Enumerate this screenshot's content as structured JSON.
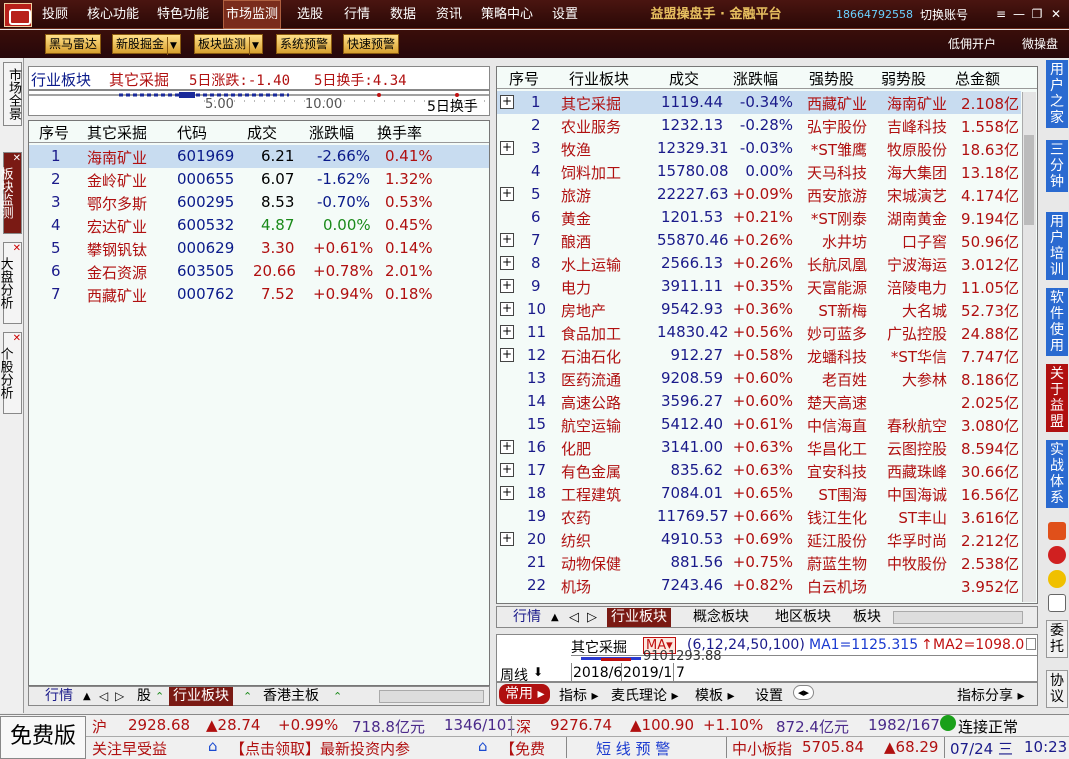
{
  "menu": {
    "items": [
      "投顾",
      "核心功能",
      "特色功能",
      "市场监测",
      "选股",
      "行情",
      "数据",
      "资讯",
      "策略中心",
      "设置"
    ],
    "active": "市场监测",
    "brand": "益盟操盘手 · 金融平台",
    "phone": "18664792558",
    "switch_account": "切换账号"
  },
  "toolbar": {
    "buttons": [
      "黑马雷达",
      "新股掘金",
      "板块监测",
      "系统预警",
      "快速预警"
    ],
    "dropdowns": [
      "新股掘金",
      "板块监测"
    ],
    "links": [
      "低佣开户",
      "微操盘"
    ]
  },
  "left_tabs": [
    "市场全景",
    "板块监测",
    "大盘分析",
    "个股分析"
  ],
  "left_panel": {
    "title": "行业板块",
    "sector": "其它采掘",
    "change5": "5日涨跌:-1.40",
    "turnover5": "5日换手:4.34",
    "strip_labels": [
      "5.00",
      "10.00",
      "5日换手"
    ],
    "headers": [
      "序号",
      "其它采掘",
      "代码",
      "成交",
      "涨跌幅",
      "换手率"
    ],
    "rows": [
      [
        "1",
        "海南矿业",
        "601969",
        "6.21",
        "-2.66%",
        "0.41%"
      ],
      [
        "2",
        "金岭矿业",
        "000655",
        "6.07",
        "-1.62%",
        "1.32%"
      ],
      [
        "3",
        "鄂尔多斯",
        "600295",
        "8.53",
        "-0.70%",
        "0.53%"
      ],
      [
        "4",
        "宏达矿业",
        "600532",
        "4.87",
        "0.00%",
        "0.45%"
      ],
      [
        "5",
        "攀钢钒钛",
        "000629",
        "3.30",
        "+0.61%",
        "0.14%"
      ],
      [
        "6",
        "金石资源",
        "603505",
        "20.66",
        "+0.78%",
        "2.01%"
      ],
      [
        "7",
        "西藏矿业",
        "000762",
        "7.52",
        "+0.94%",
        "0.18%"
      ]
    ],
    "bottom_tabs": [
      "行情",
      "股",
      "行业板块",
      "香港主板"
    ]
  },
  "right_panel": {
    "headers": [
      "序号",
      "行业板块",
      "成交",
      "涨跌幅",
      "强势股",
      "弱势股",
      "总金额"
    ],
    "rows": [
      {
        "plus": true,
        "v": [
          "1",
          "其它采掘",
          "1119.44",
          "-0.34%",
          "西藏矿业",
          "海南矿业",
          "2.108亿"
        ]
      },
      {
        "plus": false,
        "v": [
          "2",
          "农业服务",
          "1232.13",
          "-0.28%",
          "弘宇股份",
          "吉峰科技",
          "1.558亿"
        ]
      },
      {
        "plus": true,
        "v": [
          "3",
          "牧渔",
          "12329.31",
          "-0.03%",
          "*ST雏鹰",
          "牧原股份",
          "18.63亿"
        ]
      },
      {
        "plus": false,
        "v": [
          "4",
          "饲料加工",
          "15780.08",
          "0.00%",
          "天马科技",
          "海大集团",
          "13.18亿"
        ]
      },
      {
        "plus": true,
        "v": [
          "5",
          "旅游",
          "22227.63",
          "+0.09%",
          "西安旅游",
          "宋城演艺",
          "4.174亿"
        ]
      },
      {
        "plus": false,
        "v": [
          "6",
          "黄金",
          "1201.53",
          "+0.21%",
          "*ST刚泰",
          "湖南黄金",
          "9.194亿"
        ]
      },
      {
        "plus": true,
        "v": [
          "7",
          "酿酒",
          "55870.46",
          "+0.26%",
          "水井坊",
          "口子窖",
          "50.96亿"
        ]
      },
      {
        "plus": true,
        "v": [
          "8",
          "水上运输",
          "2566.13",
          "+0.26%",
          "长航凤凰",
          "宁波海运",
          "3.012亿"
        ]
      },
      {
        "plus": true,
        "v": [
          "9",
          "电力",
          "3911.11",
          "+0.35%",
          "天富能源",
          "涪陵电力",
          "11.05亿"
        ]
      },
      {
        "plus": true,
        "v": [
          "10",
          "房地产",
          "9542.93",
          "+0.36%",
          "ST新梅",
          "大名城",
          "52.73亿"
        ]
      },
      {
        "plus": true,
        "v": [
          "11",
          "食品加工",
          "14830.42",
          "+0.56%",
          "妙可蓝多",
          "广弘控股",
          "24.88亿"
        ]
      },
      {
        "plus": true,
        "v": [
          "12",
          "石油石化",
          "912.27",
          "+0.58%",
          "龙蟠科技",
          "*ST华信",
          "7.747亿"
        ]
      },
      {
        "plus": false,
        "v": [
          "13",
          "医药流通",
          "9208.59",
          "+0.60%",
          "老百姓",
          "大参林",
          "8.186亿"
        ]
      },
      {
        "plus": false,
        "v": [
          "14",
          "高速公路",
          "3596.27",
          "+0.60%",
          "楚天高速",
          "",
          "2.025亿"
        ]
      },
      {
        "plus": false,
        "v": [
          "15",
          "航空运输",
          "5412.40",
          "+0.61%",
          "中信海直",
          "春秋航空",
          "3.080亿"
        ]
      },
      {
        "plus": true,
        "v": [
          "16",
          "化肥",
          "3141.00",
          "+0.63%",
          "华昌化工",
          "云图控股",
          "8.594亿"
        ]
      },
      {
        "plus": true,
        "v": [
          "17",
          "有色金属",
          "835.62",
          "+0.63%",
          "宜安科技",
          "西藏珠峰",
          "30.66亿"
        ]
      },
      {
        "plus": true,
        "v": [
          "18",
          "工程建筑",
          "7084.01",
          "+0.65%",
          "ST围海",
          "中国海诚",
          "16.56亿"
        ]
      },
      {
        "plus": false,
        "v": [
          "19",
          "农药",
          "11769.57",
          "+0.66%",
          "钱江生化",
          "ST丰山",
          "3.616亿"
        ]
      },
      {
        "plus": true,
        "v": [
          "20",
          "纺织",
          "4910.53",
          "+0.69%",
          "延江股份",
          "华孚时尚",
          "2.212亿"
        ]
      },
      {
        "plus": false,
        "v": [
          "21",
          "动物保健",
          "881.56",
          "+0.75%",
          "蔚蓝生物",
          "中牧股份",
          "2.538亿"
        ]
      },
      {
        "plus": false,
        "v": [
          "22",
          "机场",
          "7243.46",
          "+0.82%",
          "白云机场",
          "",
          "3.952亿"
        ]
      }
    ],
    "tabs": [
      "行情",
      "行业板块",
      "概念板块",
      "地区板块",
      "板块"
    ]
  },
  "chart_panel": {
    "name": "其它采掘",
    "ma_btn": "MA",
    "params": "(6,12,24,50,100)",
    "ma1": "MA1=1125.315",
    "ma2": "MA2=1098.0",
    "overlap_text": "9101293.88",
    "period": "周线",
    "dates": [
      "2018/6",
      "2019/1",
      "7"
    ],
    "bottom": [
      "常用",
      "指标",
      "麦氏理论",
      "模板",
      "设置",
      "指标分享"
    ]
  },
  "right_nav": [
    "用户之家",
    "三分钟",
    "用户培训",
    "软件使用",
    "关于益盟",
    "实战体系",
    "委托",
    "协议"
  ],
  "status": {
    "free": "免费版",
    "sh_label": "沪",
    "sh_index": "2928.68",
    "sh_change": "▲28.74",
    "sh_pct": "+0.99%",
    "sh_amount": "718.8亿元",
    "sh_updown": "1346/101",
    "sz_label": "深",
    "sz_index": "9276.74",
    "sz_change": "▲100.90",
    "sz_pct": "+1.10%",
    "sz_amount": "872.4亿元",
    "sz_updown": "1982/167",
    "conn": "连接正常",
    "ticker1": "关注早受益",
    "ticker2": "【点击领取】最新投资内参",
    "ticker3": "【免费",
    "alert": "短 线 预 警",
    "sme_label": "中小板指",
    "sme_value": "5705.84",
    "sme_change": "▲68.29",
    "date": "07/24 三",
    "time": "10:23"
  },
  "colors": {
    "brand_red": "#7a1a14",
    "up": "#b01010",
    "down": "#1a8a1a",
    "accent_blue": "#2a6ad0"
  }
}
